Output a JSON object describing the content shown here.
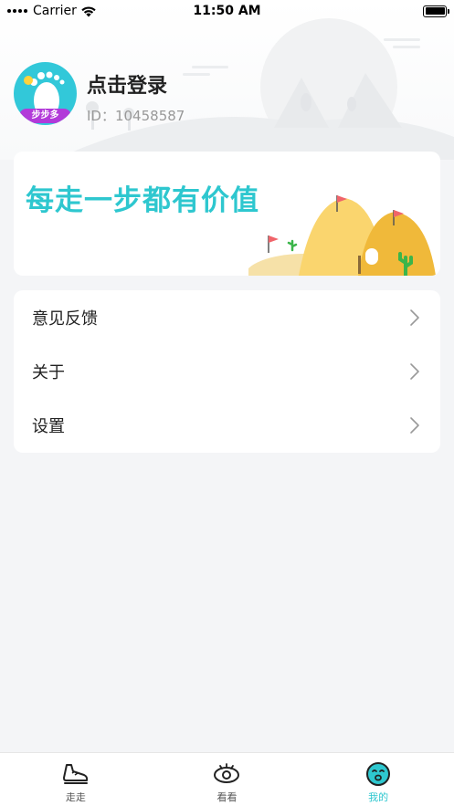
{
  "status_bar": {
    "carrier": "Carrier",
    "time": "11:50 AM"
  },
  "profile": {
    "login_text": "点击登录",
    "user_id": "ID：10458587",
    "avatar_badge": "步步多"
  },
  "banner": {
    "slogan": "每走一步都有价值"
  },
  "menu": {
    "items": [
      {
        "label": "意见反馈"
      },
      {
        "label": "关于"
      },
      {
        "label": "设置"
      }
    ]
  },
  "tabs": [
    {
      "label": "走走",
      "icon": "shoe-icon",
      "active": false
    },
    {
      "label": "看看",
      "icon": "eye-icon",
      "active": false
    },
    {
      "label": "我的",
      "icon": "face-icon",
      "active": true
    }
  ],
  "colors": {
    "accent": "#2ec7cf",
    "avatar_bg": "#32c8d9",
    "badge": "#b23ad9",
    "page_bg": "#f4f5f7"
  }
}
